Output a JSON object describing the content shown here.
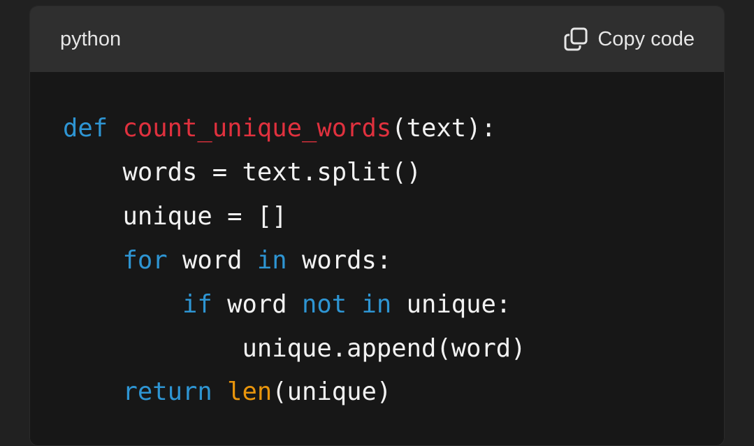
{
  "header": {
    "language": "python",
    "copy_label": "Copy code",
    "copy_icon": "copy-icon"
  },
  "code": {
    "lines": [
      [
        {
          "t": "def",
          "k": "kw"
        },
        {
          "t": " ",
          "k": "plain"
        },
        {
          "t": "count_unique_words",
          "k": "def-name"
        },
        {
          "t": "(text):",
          "k": "plain"
        }
      ],
      [
        {
          "t": "    words = text.split()",
          "k": "plain"
        }
      ],
      [
        {
          "t": "    unique = []",
          "k": "plain"
        }
      ],
      [
        {
          "t": "    ",
          "k": "plain"
        },
        {
          "t": "for",
          "k": "kw"
        },
        {
          "t": " word ",
          "k": "plain"
        },
        {
          "t": "in",
          "k": "kw"
        },
        {
          "t": " words:",
          "k": "plain"
        }
      ],
      [
        {
          "t": "        ",
          "k": "plain"
        },
        {
          "t": "if",
          "k": "kw"
        },
        {
          "t": " word ",
          "k": "plain"
        },
        {
          "t": "not",
          "k": "kw"
        },
        {
          "t": " ",
          "k": "plain"
        },
        {
          "t": "in",
          "k": "kw"
        },
        {
          "t": " unique:",
          "k": "plain"
        }
      ],
      [
        {
          "t": "            unique.append(word)",
          "k": "plain"
        }
      ],
      [
        {
          "t": "    ",
          "k": "plain"
        },
        {
          "t": "return",
          "k": "kw"
        },
        {
          "t": " ",
          "k": "plain"
        },
        {
          "t": "len",
          "k": "builtin"
        },
        {
          "t": "(unique)",
          "k": "plain"
        }
      ]
    ]
  },
  "colors": {
    "keyword": "#2e95d3",
    "function_name": "#e0313e",
    "builtin": "#e9950c",
    "text": "#f2f2f2",
    "header_bg": "#2f2f2f",
    "code_bg": "#171717"
  }
}
